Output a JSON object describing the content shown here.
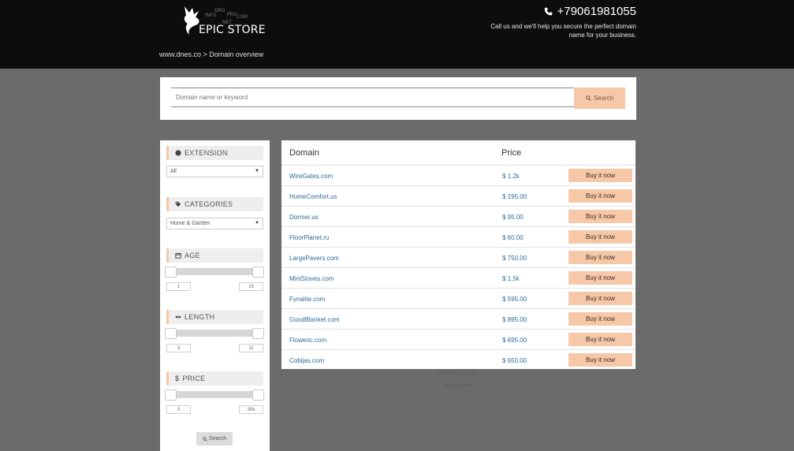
{
  "header": {
    "logo_text": "EPIC STORE",
    "logo_tlds": [
      "ORG",
      "INFO",
      "PRO",
      "COM",
      "NET"
    ],
    "phone": "+79061981055",
    "tagline": "Call us and we'll help you secure the perfect domain name for your business.",
    "breadcrumb": "www.dnes.co > Domain overview"
  },
  "search": {
    "placeholder": "Domain name or keyword",
    "button_label": "Search"
  },
  "sidebar": {
    "extension": {
      "title": "EXTENSION",
      "selected": "All"
    },
    "categories": {
      "title": "CATEGORIES",
      "selected": "Home & Garden"
    },
    "age": {
      "title": "AGE",
      "min": "1",
      "max": "15"
    },
    "length": {
      "title": "LENGTH",
      "min": "3",
      "max": "11"
    },
    "price": {
      "title": "PRICE",
      "min": "0",
      "max": "30k"
    },
    "search_label": "Search"
  },
  "results": {
    "headers": {
      "domain": "Domain",
      "price": "Price"
    },
    "buy_label": "Buy it now",
    "rows": [
      {
        "domain": "WireGates.com",
        "price": "$ 1.2k"
      },
      {
        "domain": "HomeComfort.us",
        "price": "$ 195.00"
      },
      {
        "domain": "Dormer.us",
        "price": "$ 95.00"
      },
      {
        "domain": "FloorPlanet.ru",
        "price": "$ 60.00"
      },
      {
        "domain": "LargePavers.com",
        "price": "$ 750.00"
      },
      {
        "domain": "MiniStoves.com",
        "price": "$ 1.5k"
      },
      {
        "domain": "Fynalite.com",
        "price": "$ 595.00"
      },
      {
        "domain": "GoodBlanket.com",
        "price": "$ 895.00"
      },
      {
        "domain": "Floweric.com",
        "price": "$ 695.00"
      },
      {
        "domain": "Cobijas.com",
        "price": "$ 650.00"
      }
    ],
    "showing": "Showing 1 of 11",
    "show_more": "Show more"
  },
  "colors": {
    "header_bg": "#0d0d0d",
    "page_bg": "#6b6b6b",
    "accent": "#f6c8a8",
    "link": "#2b6b9a"
  }
}
